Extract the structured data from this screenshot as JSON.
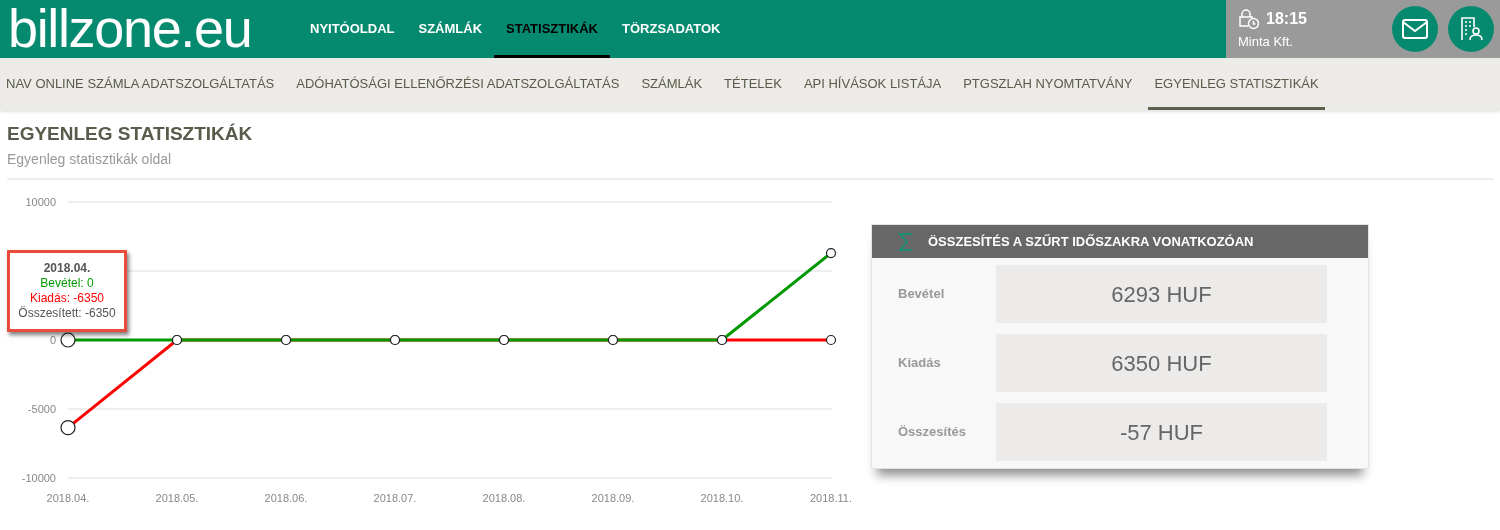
{
  "header": {
    "logo": "billzone.eu",
    "nav": [
      {
        "label": "NYITÓOLDAL",
        "selected": false
      },
      {
        "label": "SZÁMLÁK",
        "selected": false
      },
      {
        "label": "STATISZTIKÁK",
        "selected": true
      },
      {
        "label": "TÖRZSADATOK",
        "selected": false
      }
    ],
    "time": "18:15",
    "company": "Minta Kft."
  },
  "subnav": [
    {
      "label": "NAV ONLINE SZÁMLA ADATSZOLGÁLTATÁS",
      "selected": false
    },
    {
      "label": "ADÓHATÓSÁGI ELLENŐRZÉSI ADATSZOLGÁLTATÁS",
      "selected": false
    },
    {
      "label": "SZÁMLÁK",
      "selected": false
    },
    {
      "label": "TÉTELEK",
      "selected": false
    },
    {
      "label": "API HÍVÁSOK LISTÁJA",
      "selected": false
    },
    {
      "label": "PTGSZLAH NYOMTATVÁNY",
      "selected": false
    },
    {
      "label": "EGYENLEG STATISZTIKÁK",
      "selected": true
    }
  ],
  "page": {
    "title": "EGYENLEG STATISZTIKÁK",
    "subtitle": "Egyenleg statisztikák oldal"
  },
  "chart": {
    "chart_data": {
      "type": "line",
      "categories": [
        "2018.04.",
        "2018.05.",
        "2018.06.",
        "2018.07.",
        "2018.08.",
        "2018.09.",
        "2018.10.",
        "2018.11."
      ],
      "ylim": [
        -10000,
        10000
      ],
      "yticks": [
        -10000,
        -5000,
        0,
        10000
      ],
      "series": [
        {
          "color": "#ff0000",
          "marker": "circle",
          "values": [
            -6350,
            0,
            0,
            0,
            0,
            0,
            0,
            0
          ]
        },
        {
          "color": "#009900",
          "marker": "circle",
          "values": [
            0,
            0,
            0,
            0,
            0,
            0,
            0,
            6300
          ]
        }
      ]
    },
    "tooltip": {
      "title": "2018.04.",
      "lines": [
        {
          "text": "Bevétel: 0",
          "color": "#009900"
        },
        {
          "text": "Kiadás: -6350",
          "color": "#ff0000"
        },
        {
          "text": "Összesített: -6350",
          "color": "#555555"
        }
      ]
    }
  },
  "summary": {
    "title": "ÖSSZESÍTÉS A SZŰRT IDŐSZAKRA VONATKOZÓAN",
    "rows": [
      {
        "label": "Bevétel",
        "value": "6293 HUF"
      },
      {
        "label": "Kiadás",
        "value": "6350 HUF"
      },
      {
        "label": "Összesítés",
        "value": "-57 HUF"
      }
    ]
  }
}
